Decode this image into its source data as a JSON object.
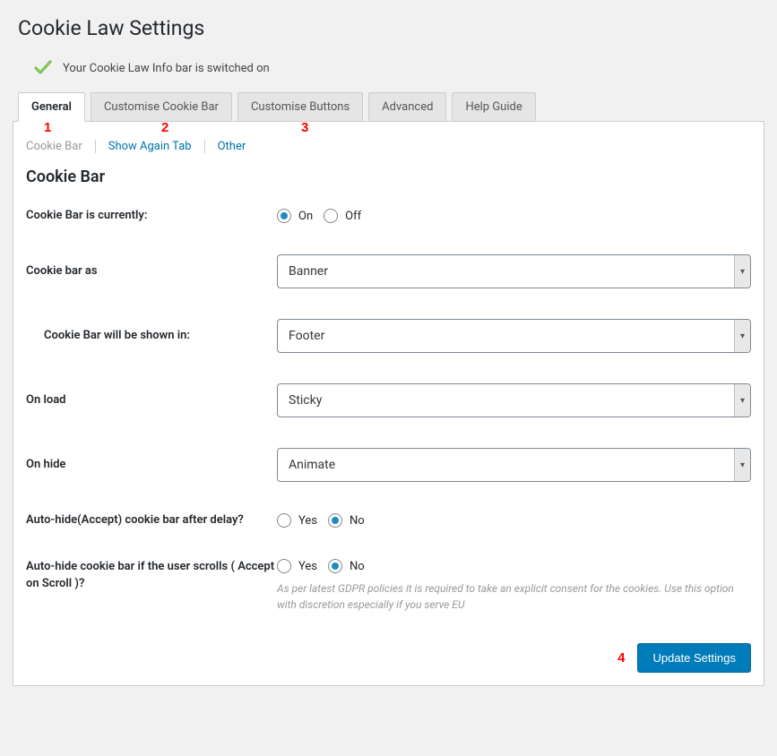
{
  "header": {
    "title": "Cookie Law Settings",
    "status_text": "Your Cookie Law Info bar is switched on"
  },
  "tabs": {
    "general": "General",
    "customise_bar": "Customise Cookie Bar",
    "customise_buttons": "Customise Buttons",
    "advanced": "Advanced",
    "help": "Help Guide"
  },
  "subtabs": {
    "cookie_bar": "Cookie Bar",
    "show_again": "Show Again Tab",
    "other": "Other"
  },
  "section": {
    "title": "Cookie Bar"
  },
  "fields": {
    "currently_label": "Cookie Bar is currently:",
    "currently_on": "On",
    "currently_off": "Off",
    "bar_as_label": "Cookie bar as",
    "bar_as_value": "Banner",
    "shown_in_label": "Cookie Bar will be shown in:",
    "shown_in_value": "Footer",
    "on_load_label": "On load",
    "on_load_value": "Sticky",
    "on_hide_label": "On hide",
    "on_hide_value": "Animate",
    "autohide_delay_label": "Auto-hide(Accept) cookie bar after delay?",
    "autohide_scroll_label": "Auto-hide cookie bar if the user scrolls ( Accept on Scroll )?",
    "yes": "Yes",
    "no": "No",
    "scroll_help": "As per latest GDPR policies it is required to take an explicit consent for the cookies. Use this option with discretion especially if you serve EU"
  },
  "footer": {
    "save_label": "Update Settings"
  },
  "markers": {
    "m1": "1",
    "m2": "2",
    "m3": "3",
    "m4": "4"
  }
}
